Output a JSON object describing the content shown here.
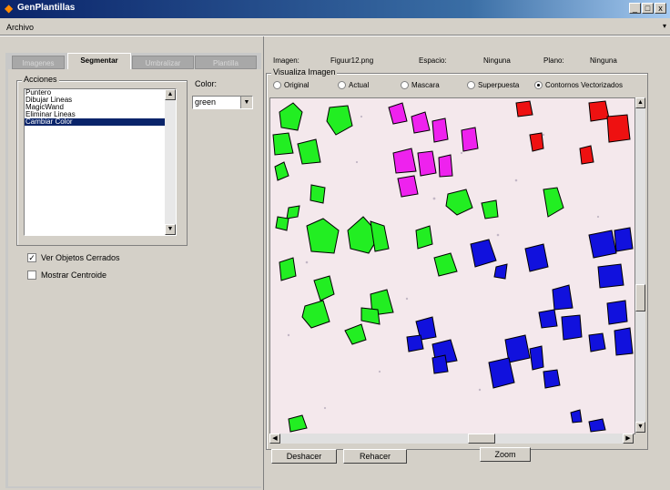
{
  "window": {
    "title": "GenPlantillas",
    "app_icon": "matlab-logo-icon",
    "minimize": "_",
    "maximize": "□",
    "close": "x"
  },
  "menu": {
    "items": [
      "Archivo"
    ],
    "arrow": "▾"
  },
  "tabs": [
    {
      "label": "Imagenes",
      "active": false
    },
    {
      "label": "Segmentar",
      "active": true
    },
    {
      "label": "Umbralizar",
      "active": false
    },
    {
      "label": "Plantilla",
      "active": false
    }
  ],
  "acciones": {
    "legend": "Acciones",
    "items": [
      "Puntero",
      "Dibujar Lineas",
      "MagicWand",
      "Eliminar Lineas",
      "Cambiar Color"
    ],
    "selected_index": 4
  },
  "color": {
    "label": "Color:",
    "value": "green"
  },
  "checkboxes": [
    {
      "label": "Ver Objetos Cerrados",
      "checked": true
    },
    {
      "label": "Mostrar Centroide",
      "checked": false
    }
  ],
  "info": {
    "imagen_label": "Imagen:",
    "imagen_value": "Figuur12.png",
    "espacio_label": "Espacio:",
    "espacio_value": "Ninguna",
    "plano_label": "Plano:",
    "plano_value": "Ninguna"
  },
  "visualiza": {
    "legend": "Visualiza Imagen",
    "options": [
      "Original",
      "Actual",
      "Mascara",
      "Superpuesta",
      "Contornos Vectorizados"
    ],
    "selected_index": 4
  },
  "buttons": {
    "undo": "Deshacer",
    "redo": "Rehacer",
    "zoom": "Zoom"
  },
  "colors": {
    "green": "#22ee22",
    "magenta": "#ee22ee",
    "red": "#ee1111",
    "blue": "#1111dd"
  }
}
